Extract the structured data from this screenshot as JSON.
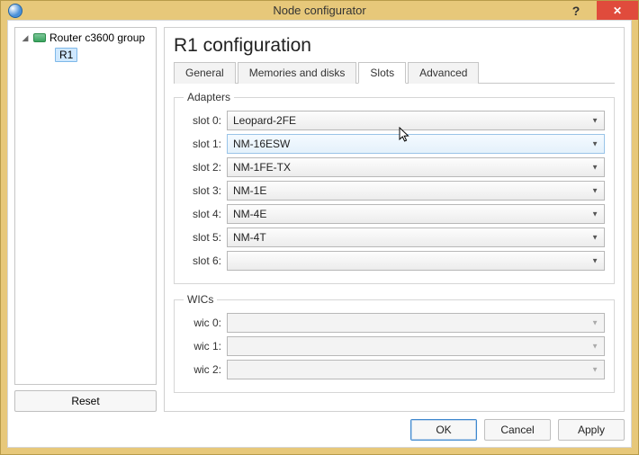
{
  "window": {
    "title": "Node configurator"
  },
  "tree": {
    "group_label": "Router c3600 group",
    "selected_node": "R1"
  },
  "side": {
    "reset_label": "Reset"
  },
  "header": {
    "title": "R1 configuration"
  },
  "tabs": {
    "general": "General",
    "memories": "Memories and disks",
    "slots": "Slots",
    "advanced": "Advanced"
  },
  "adapters": {
    "legend": "Adapters",
    "rows": [
      {
        "label": "slot 0:",
        "value": "Leopard-2FE",
        "enabled": true,
        "highlight": false
      },
      {
        "label": "slot 1:",
        "value": "NM-16ESW",
        "enabled": true,
        "highlight": true
      },
      {
        "label": "slot 2:",
        "value": "NM-1FE-TX",
        "enabled": true,
        "highlight": false
      },
      {
        "label": "slot 3:",
        "value": "NM-1E",
        "enabled": true,
        "highlight": false
      },
      {
        "label": "slot 4:",
        "value": "NM-4E",
        "enabled": true,
        "highlight": false
      },
      {
        "label": "slot 5:",
        "value": "NM-4T",
        "enabled": true,
        "highlight": false
      },
      {
        "label": "slot 6:",
        "value": "",
        "enabled": true,
        "highlight": false
      }
    ]
  },
  "wics": {
    "legend": "WICs",
    "rows": [
      {
        "label": "wic 0:",
        "value": "",
        "enabled": false
      },
      {
        "label": "wic 1:",
        "value": "",
        "enabled": false
      },
      {
        "label": "wic 2:",
        "value": "",
        "enabled": false
      }
    ]
  },
  "buttons": {
    "ok": "OK",
    "cancel": "Cancel",
    "apply": "Apply"
  }
}
